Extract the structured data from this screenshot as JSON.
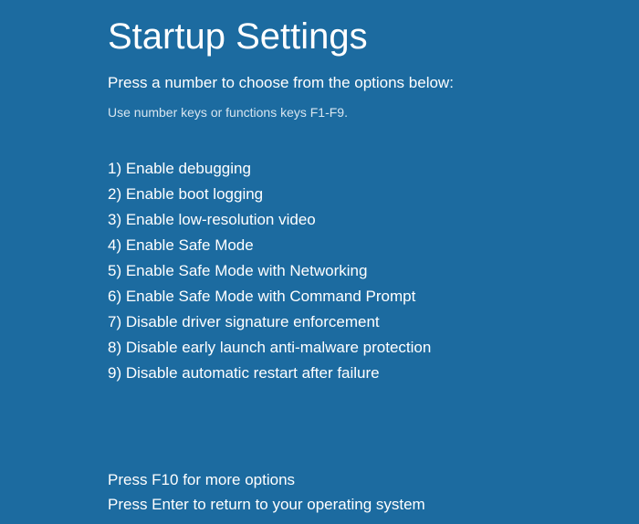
{
  "title": "Startup Settings",
  "instruction": "Press a number to choose from the options below:",
  "hint": "Use number keys or functions keys F1-F9.",
  "options": [
    "1) Enable debugging",
    "2) Enable boot logging",
    "3) Enable low-resolution video",
    "4) Enable Safe Mode",
    "5) Enable Safe Mode with Networking",
    "6) Enable Safe Mode with Command Prompt",
    "7) Disable driver signature enforcement",
    "8) Disable early launch anti-malware protection",
    "9) Disable automatic restart after failure"
  ],
  "footer": {
    "more_options": "Press F10 for more options",
    "return": "Press Enter to return to your operating system"
  }
}
